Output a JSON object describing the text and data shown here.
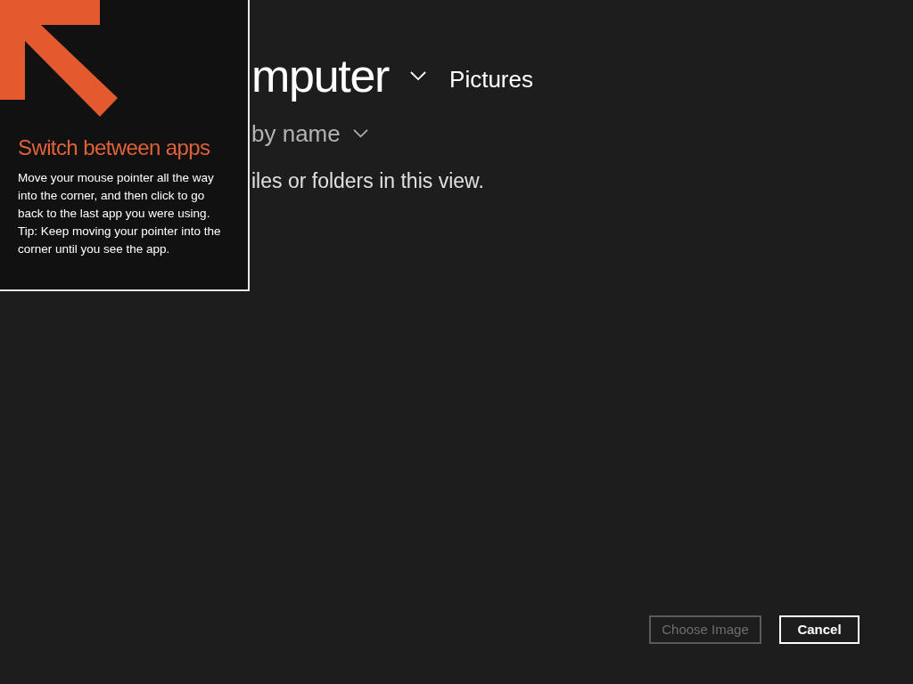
{
  "header": {
    "location": "mputer",
    "folder": "Pictures"
  },
  "sort": {
    "label": "by name"
  },
  "message": "iles or folders in this view.",
  "tip": {
    "title": "Switch between apps",
    "body": [
      "Move your mouse pointer all the way into the corner, and then click to go back to the last app you were using.",
      "Tip: Keep moving your pointer into the corner until you see the app."
    ]
  },
  "buttons": [
    {
      "label": "Choose Image",
      "disabled": true
    },
    {
      "label": "Cancel",
      "disabled": false
    }
  ]
}
